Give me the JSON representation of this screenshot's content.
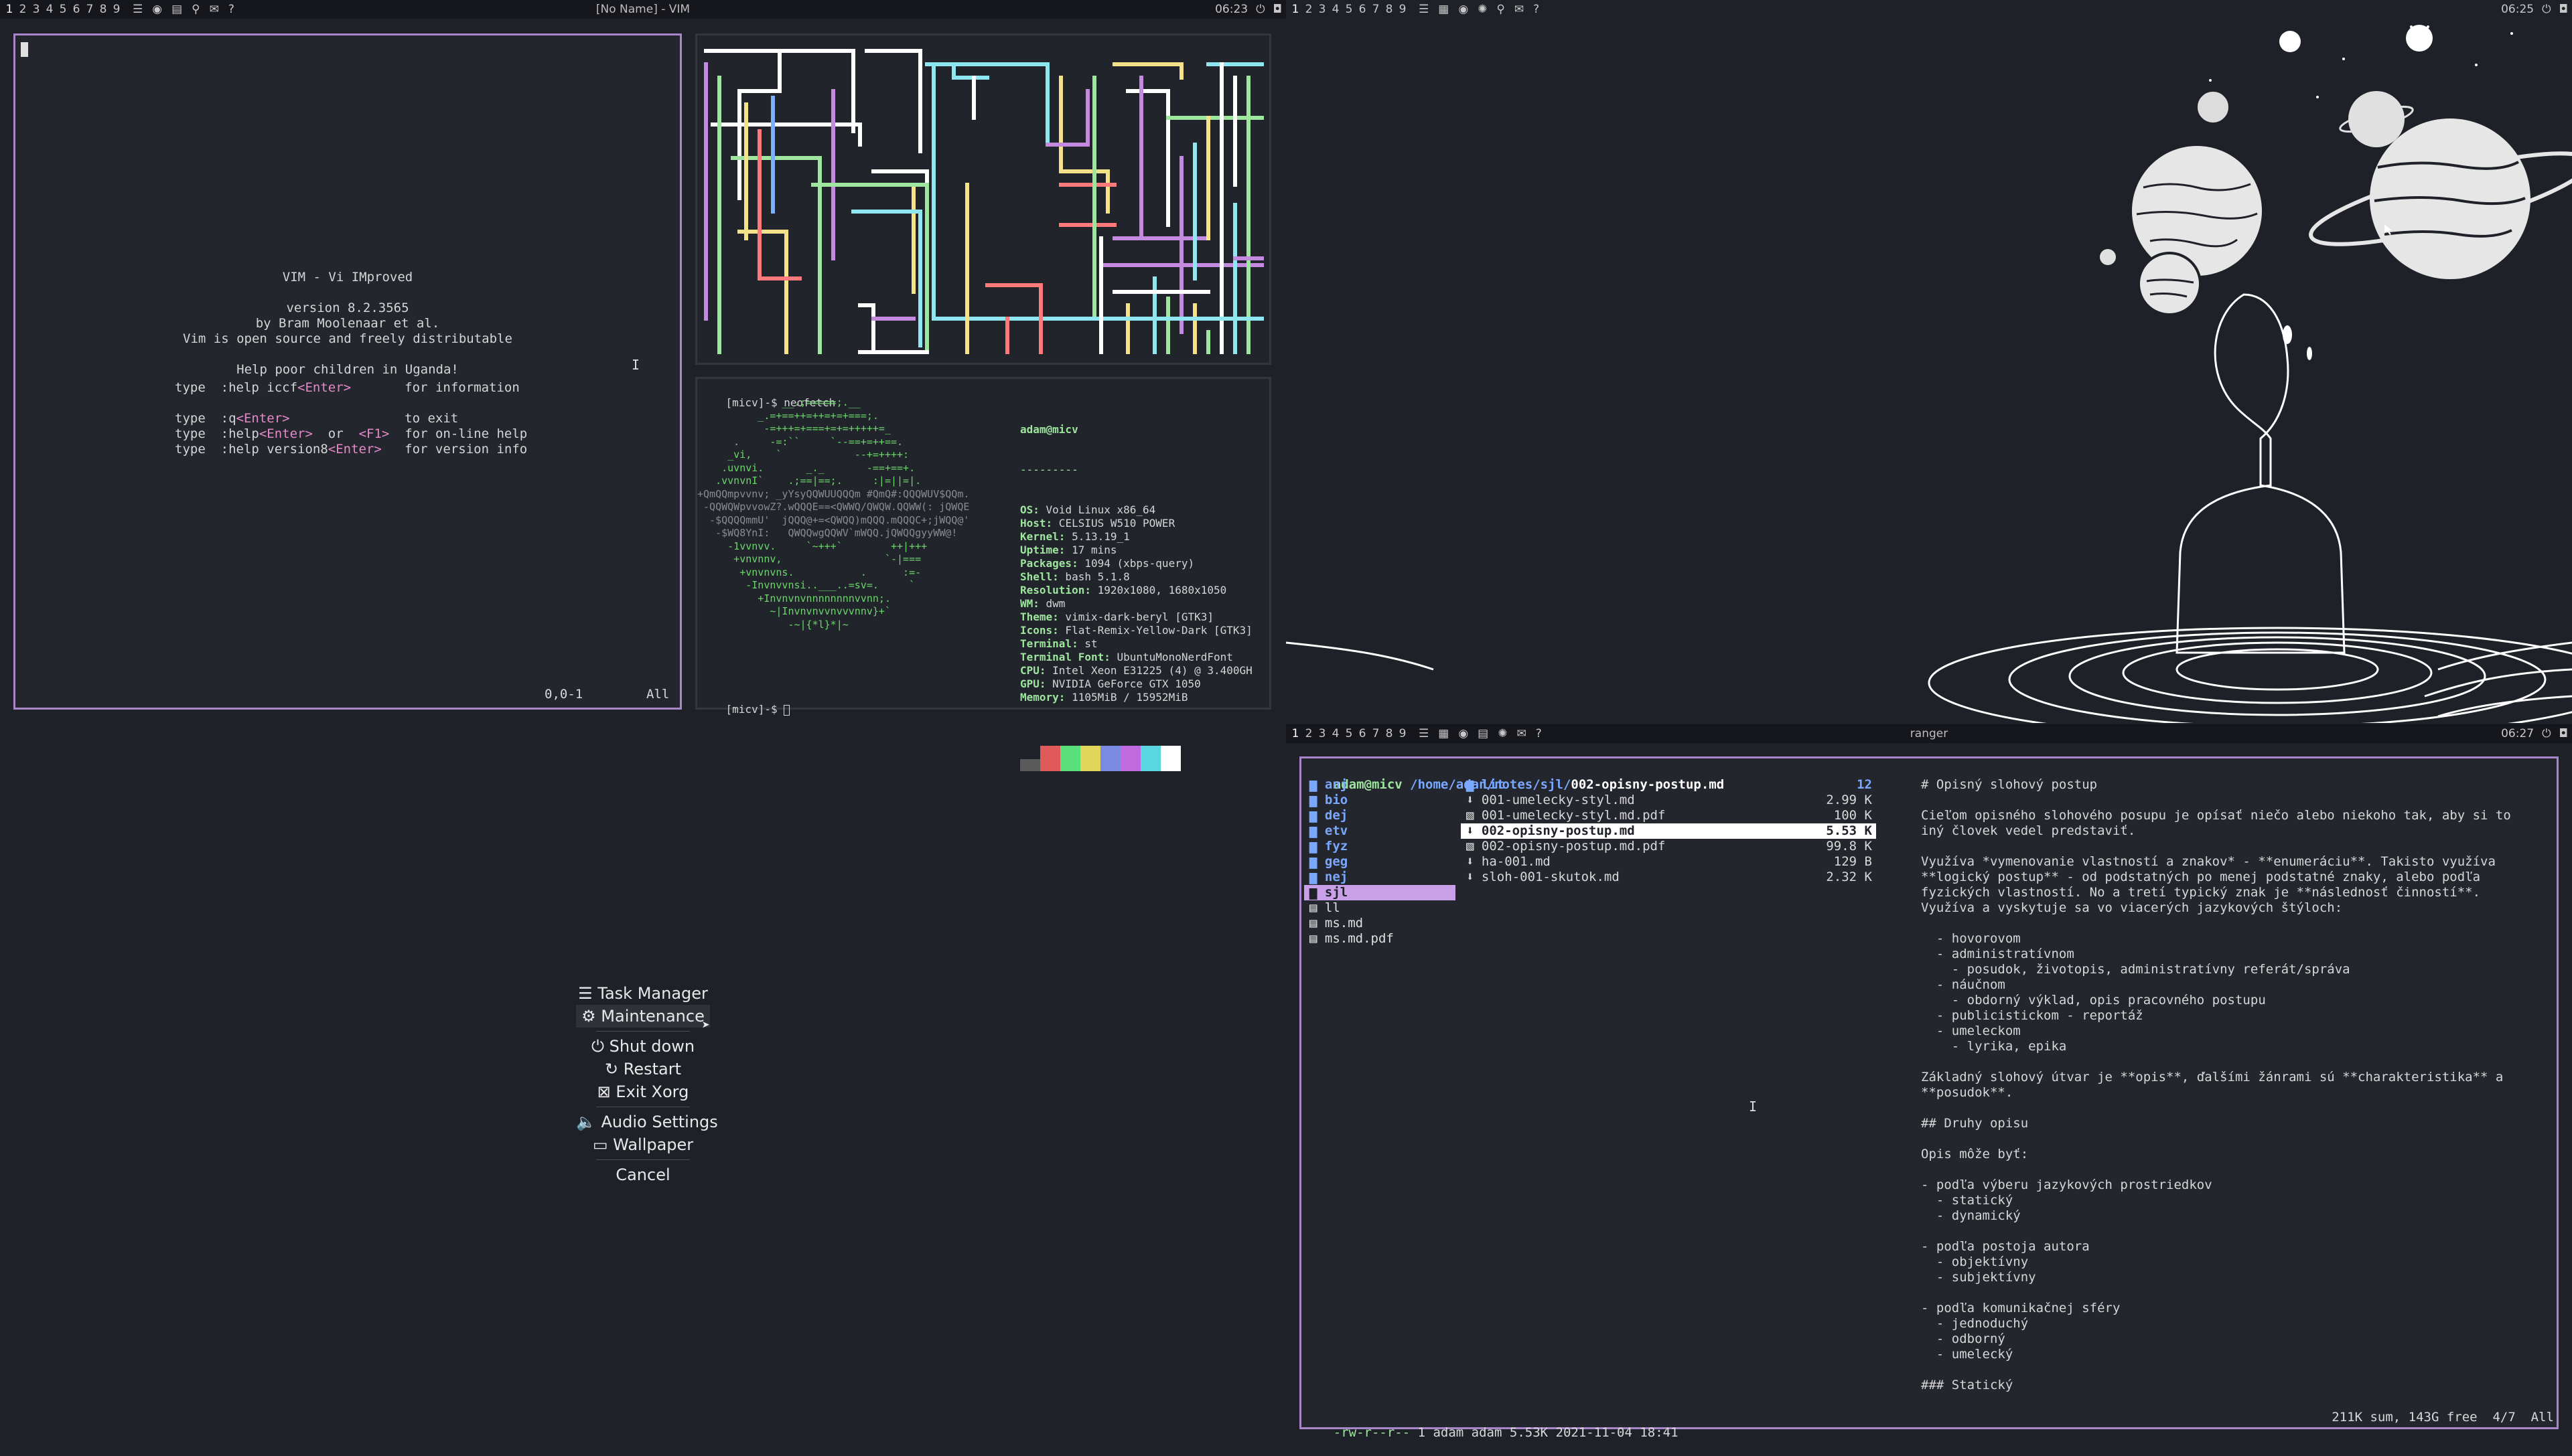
{
  "bars": {
    "left": {
      "tags": [
        "1",
        "2",
        "3",
        "4",
        "5",
        "6",
        "7",
        "8",
        "9"
      ],
      "title": "[No Name] - VIM",
      "time": "06:23"
    },
    "right_top": {
      "tags": [
        "1",
        "2",
        "3",
        "4",
        "5",
        "6",
        "7",
        "8",
        "9"
      ],
      "title": "",
      "time": "06:25"
    },
    "right_bottom": {
      "tags": [
        "1",
        "2",
        "3",
        "4",
        "5",
        "6",
        "7",
        "8",
        "9"
      ],
      "title": "ranger",
      "time": "06:27"
    }
  },
  "vim": {
    "intro": [
      "VIM - Vi IMproved",
      "",
      "version 8.2.3565",
      "by Bram Moolenaar et al.",
      "Vim is open source and freely distributable",
      "",
      "Help poor children in Uganda!"
    ],
    "help": [
      {
        "a": "type  :help iccf",
        "k": "<Enter>",
        "b": "       for information"
      },
      {
        "a": "",
        "k": "",
        "b": ""
      },
      {
        "a": "type  :q",
        "k": "<Enter>",
        "b": "               to exit"
      },
      {
        "a": "type  :help",
        "k": "<Enter>",
        "b": "  or  ",
        "k2": "<F1>",
        "c": "  for on-line help"
      },
      {
        "a": "type  :help version8",
        "k": "<Enter>",
        "b": "   for version info"
      }
    ],
    "pos": "0,0-1",
    "scroll": "All"
  },
  "terminal": {
    "prompt": "[micv]-$",
    "command": "neofetch",
    "prompt2": "[micv]-$",
    "user": "adam@micv",
    "sep": "---------",
    "info": [
      {
        "k": "OS",
        "v": "Void Linux x86_64"
      },
      {
        "k": "Host",
        "v": "CELSIUS W510 POWER"
      },
      {
        "k": "Kernel",
        "v": "5.13.19_1"
      },
      {
        "k": "Uptime",
        "v": "17 mins"
      },
      {
        "k": "Packages",
        "v": "1094 (xbps-query)"
      },
      {
        "k": "Shell",
        "v": "bash 5.1.8"
      },
      {
        "k": "Resolution",
        "v": "1920x1080, 1680x1050"
      },
      {
        "k": "WM",
        "v": "dwm"
      },
      {
        "k": "Theme",
        "v": "vimix-dark-beryl [GTK3]"
      },
      {
        "k": "Icons",
        "v": "Flat-Remix-Yellow-Dark [GTK3]"
      },
      {
        "k": "Terminal",
        "v": "st"
      },
      {
        "k": "Terminal Font",
        "v": "UbuntuMonoNerdFont"
      },
      {
        "k": "CPU",
        "v": "Intel Xeon E31225 (4) @ 3.400GH"
      },
      {
        "k": "GPU",
        "v": "NVIDIA GeForce GTX 1050"
      },
      {
        "k": "Memory",
        "v": "1105MiB / 15952MiB"
      }
    ],
    "art": [
      "              __.;=====;.__",
      "          _.=+==++=++=+=+===;.",
      "           -=+++=+===+=+=+++++=_",
      "      .     -=:``     `--==+=++==.",
      "     _vi,    `            --+=++++:",
      "    .uvnvi.       _._       -==+==+.",
      "   .vvnvnI`    .;==|==;.     :|=||=|.",
      "+QmQQmpvvnv; _yYsyQQWUUQQQm #QmQ#:QQQWUV$QQm.",
      " -QQWQWpvvowZ?.wQQQE==<QWWQ/QWQW.QQWW(: jQWQE",
      "  -$QQQQmmU'  jQQQ@+=<QWQQ)mQQQ.mQQQC+;jWQQ@'",
      "   -$WQ8YnI:   QWQQwgQQWV`mWQQ.jQWQQgyyWW@!",
      "     -1vvnvv.     `~+++`        ++|+++",
      "      +vnvnnv,                 `-|===",
      "       +vnvnvns.           .      :=-",
      "        -Invnvvnsi..___..=sv=.     `",
      "          +Invnvnvnnnnnnnnvvnn;.",
      "            ~|Invnvnvvnvvvnnv}+`",
      "               -~|{*l}*|~"
    ],
    "palette": [
      "#5a5a5a",
      "#e05a5a",
      "#5ae07a",
      "#e0d65a",
      "#7a8ae0",
      "#c06ae0",
      "#5ad6e0",
      "#ffffff"
    ]
  },
  "dwm_menu": {
    "items": [
      {
        "icon": "☰",
        "label": "Task Manager",
        "selected": false
      },
      {
        "icon": "⚙",
        "label": "Maintenance",
        "selected": true
      },
      {
        "icon": "⏻",
        "label": "Shut down",
        "selected": false
      },
      {
        "icon": "↻",
        "label": "Restart",
        "selected": false
      },
      {
        "icon": "⊠",
        "label": "Exit Xorg",
        "selected": false
      },
      {
        "icon": "🔈",
        "label": "Audio Settings",
        "selected": false
      },
      {
        "icon": "▭",
        "label": "Wallpaper",
        "selected": false
      },
      {
        "icon": "",
        "label": "Cancel",
        "selected": false
      }
    ]
  },
  "ranger": {
    "header_user": "adam@micv",
    "header_path": "/home/adan/notes/sjl/",
    "header_file": "002-opisny-postup.md",
    "col1": [
      {
        "name": "anj",
        "dir": true
      },
      {
        "name": "bio",
        "dir": true
      },
      {
        "name": "dej",
        "dir": true
      },
      {
        "name": "etv",
        "dir": true
      },
      {
        "name": "fyz",
        "dir": true
      },
      {
        "name": "geg",
        "dir": true
      },
      {
        "name": "nej",
        "dir": true
      },
      {
        "name": "sjl",
        "dir": true,
        "sel": true
      },
      {
        "name": "ll",
        "dir": false
      },
      {
        "name": "ms.md",
        "dir": false
      },
      {
        "name": "ms.md.pdf",
        "dir": false
      }
    ],
    "col2": [
      {
        "name": "lit",
        "size": "12",
        "dir": true
      },
      {
        "name": "001-umelecky-styl.md",
        "size": "2.99 K"
      },
      {
        "name": "001-umelecky-styl.md.pdf",
        "size": "100 K"
      },
      {
        "name": "002-opisny-postup.md",
        "size": "5.53 K",
        "sel": true
      },
      {
        "name": "002-opisny-postup.md.pdf",
        "size": "99.8 K"
      },
      {
        "name": "ha-001.md",
        "size": "129 B"
      },
      {
        "name": "sloh-001-skutok.md",
        "size": "2.32 K"
      }
    ],
    "preview": [
      "# Opisný slohový postup",
      "",
      "Cieľom opisného slohového posupu je opísať niečo alebo niekoho tak, aby si to",
      "iný človek vedel predstaviť.",
      "",
      "Využíva *vymenovanie vlastností a znakov* - **enumeráciu**. Takisto využíva",
      "**logický postup** - od podstatných po menej podstatné znaky, alebo podľa",
      "fyzických vlastností. No a tretí typický znak je **následnosť činností**.",
      "Využíva a vyskytuje sa vo viacerých jazykových štýloch:",
      "",
      "  - hovorovom",
      "  - administratívnom",
      "    - posudok, životopis, administratívny referát/správa",
      "  - náučnom",
      "    - obdorný výklad, opis pracovného postupu",
      "  - publicistickom - reportáž",
      "  - umeleckom",
      "    - lyrika, epika",
      "",
      "Základný slohový útvar je **opis**, ďalšími žánrami sú **charakteristika** a",
      "**posudok**.",
      "",
      "## Druhy opisu",
      "",
      "Opis môže byť:",
      "",
      "- podľa výberu jazykových prostriedkov",
      "  - statický",
      "  - dynamický",
      "",
      "- podľa postoja autora",
      "  - objektívny",
      "  - subjektívny",
      "",
      "- podľa komunikačnej sféry",
      "  - jednoduchý",
      "  - odborný",
      "  - umelecký",
      "",
      "### Statický"
    ],
    "status_perm": "-rw-r--r--",
    "status_info": "1 adam adam 5.53K 2021-11-04 18:41",
    "status_right": "211K sum, 143G free  4/7  All"
  },
  "colors": {
    "accent": "#a786c9",
    "bg": "#1f2128",
    "pane": "#24262d",
    "dir": "#7aa8ff",
    "green": "#9ee59e"
  }
}
